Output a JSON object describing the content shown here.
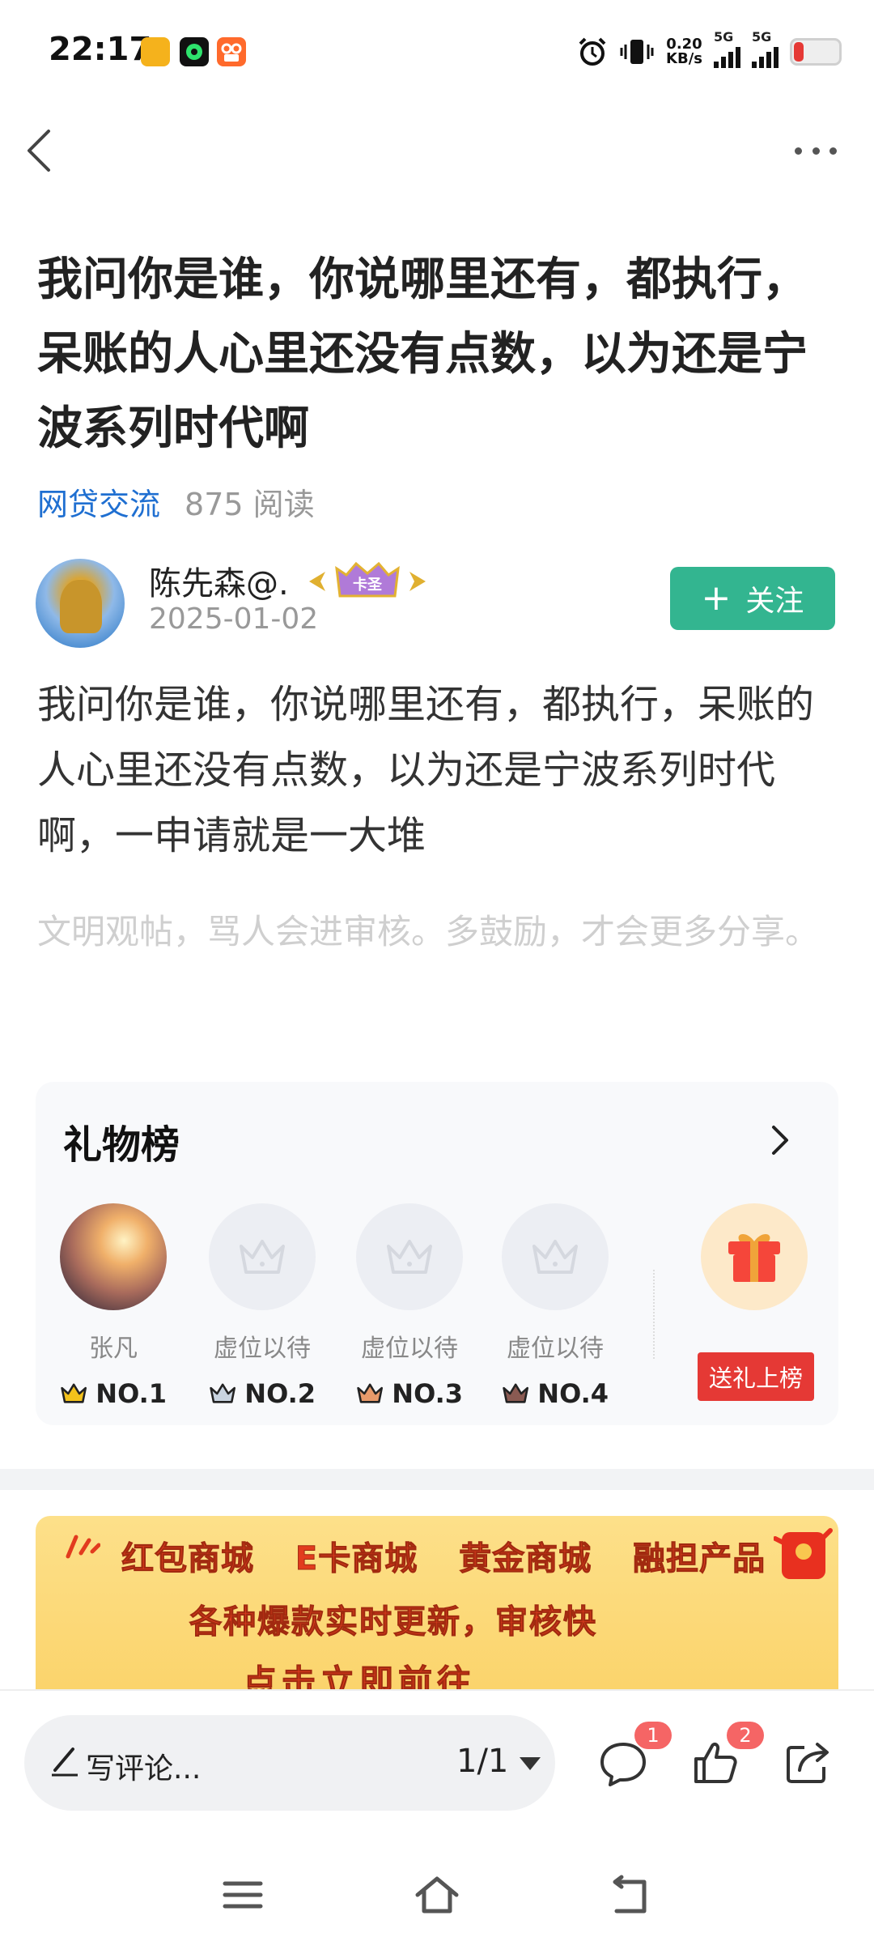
{
  "status_bar": {
    "time": "22:17",
    "net_speed_value": "0.20",
    "net_speed_unit": "KB/s",
    "sim1": "5G",
    "sim2": "5G"
  },
  "article": {
    "title": "我问你是谁，你说哪里还有，都执行，呆账的人心里还没有点数，以为还是宁波系列时代啊",
    "category": "网贷交流",
    "reads": "875 阅读",
    "author_name": "陈先森@.",
    "author_badge": "卡圣",
    "date": "2025-01-02",
    "follow_label": "关注",
    "body": "我问你是谁，你说哪里还有，都执行，呆账的人心里还没有点数，以为还是宁波系列时代啊，一申请就是一大堆",
    "hint": "文明观帖，骂人会进审核。多鼓励，才会更多分享。"
  },
  "gift_board": {
    "title": "礼物榜",
    "slots": [
      {
        "name": "张凡",
        "rank": "NO.1"
      },
      {
        "name": "虚位以待",
        "rank": "NO.2"
      },
      {
        "name": "虚位以待",
        "rank": "NO.3"
      },
      {
        "name": "虚位以待",
        "rank": "NO.4"
      }
    ],
    "send_label": "送礼上榜"
  },
  "banner": {
    "row1": "红包商城 E卡商城 黄金商城 融担产品",
    "row2": "各种爆款实时更新，审核快",
    "row3": "点击立即前往"
  },
  "bottom_bar": {
    "comment_placeholder": "写评论...",
    "page_indicator": "1/1",
    "comment_count": "1",
    "like_count": "2"
  },
  "colors": {
    "accent_green": "#33b590",
    "category_blue": "#1f6fd1",
    "send_red": "#e53935"
  }
}
